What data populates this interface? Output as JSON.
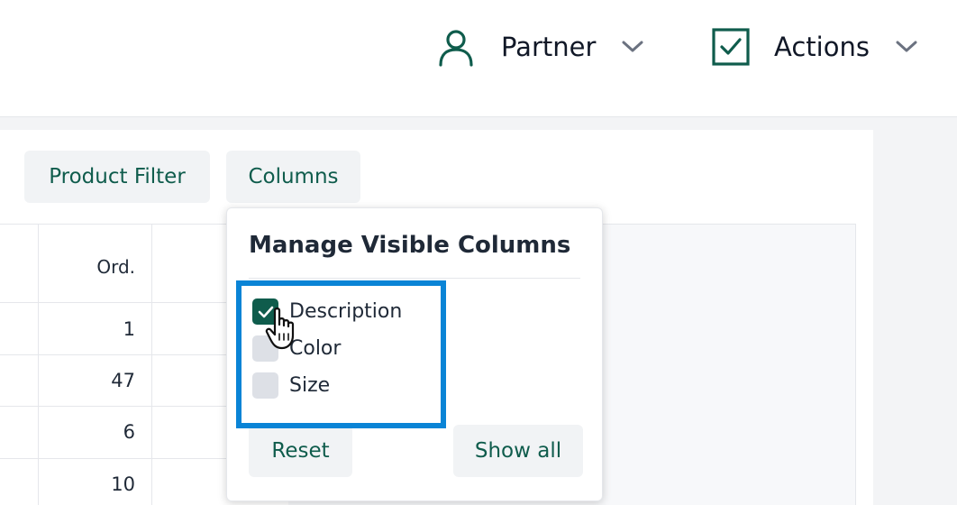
{
  "topbar": {
    "partner_label": "Partner",
    "actions_label": "Actions",
    "icons": {
      "partner": "user-icon",
      "actions": "checkbox-icon",
      "dropdown": "chevron-down-icon"
    }
  },
  "toolbar": {
    "product_filter_label": "Product Filter",
    "columns_label": "Columns"
  },
  "table": {
    "header_ord": "Ord.",
    "rows": [
      {
        "ord": "1"
      },
      {
        "ord": "47"
      },
      {
        "ord": "6"
      },
      {
        "ord": "10"
      }
    ]
  },
  "columns_dropdown": {
    "title": "Manage Visible Columns",
    "options": [
      {
        "label": "Description",
        "checked": true
      },
      {
        "label": "Color",
        "checked": false
      },
      {
        "label": "Size",
        "checked": false
      }
    ],
    "reset_label": "Reset",
    "show_all_label": "Show all"
  },
  "colors": {
    "accent": "#0f5c4c",
    "highlight": "#0a84d6",
    "button_bg": "#f1f3f5"
  }
}
